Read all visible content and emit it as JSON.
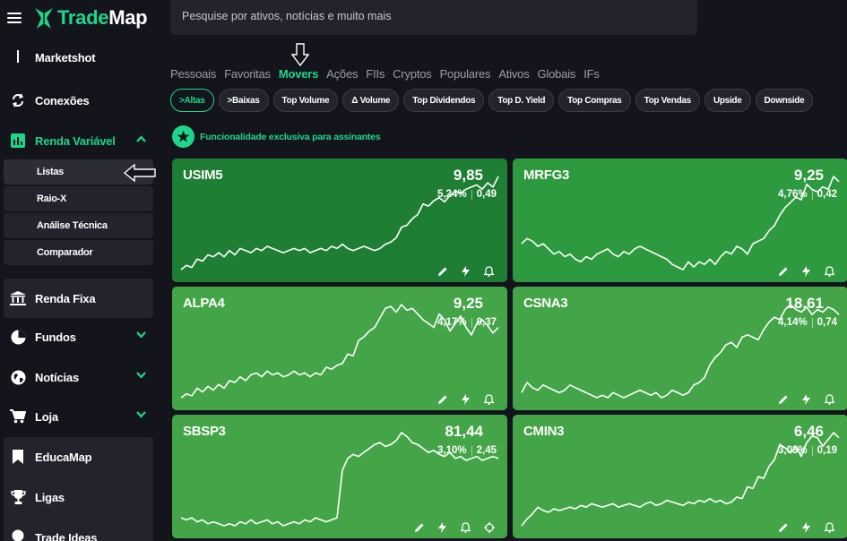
{
  "brand": {
    "name_green": "Trade",
    "name_white": "Map"
  },
  "search": {
    "placeholder": "Pesquise por ativos, notícias e muito mais"
  },
  "sidebar": {
    "partial_item": "Marketshot",
    "items": [
      {
        "label": "Conexões",
        "icon": "sync-icon"
      },
      {
        "label": "Renda Variável",
        "icon": "bar-chart-icon"
      },
      {
        "label": "Renda Fixa",
        "icon": "bank-icon"
      },
      {
        "label": "Fundos",
        "icon": "pie-chart-icon"
      },
      {
        "label": "Notícias",
        "icon": "globe-icon"
      },
      {
        "label": "Loja",
        "icon": "cart-icon"
      },
      {
        "label": "EducaMap",
        "icon": "bookmark-icon"
      },
      {
        "label": "Ligas",
        "icon": "trophy-icon"
      },
      {
        "label": "Trade Ideas",
        "icon": "lightbulb-icon"
      }
    ],
    "sub_items": [
      {
        "label": "Listas"
      },
      {
        "label": "Raio-X"
      },
      {
        "label": "Análise Técnica"
      },
      {
        "label": "Comparador"
      }
    ]
  },
  "tabs": [
    {
      "label": "Pessoais"
    },
    {
      "label": "Favoritas"
    },
    {
      "label": "Movers"
    },
    {
      "label": "Ações"
    },
    {
      "label": "FIIs"
    },
    {
      "label": "Cryptos"
    },
    {
      "label": "Populares"
    },
    {
      "label": "Ativos"
    },
    {
      "label": "Globais"
    },
    {
      "label": "IFs"
    }
  ],
  "active_tab": "Movers",
  "chips": [
    {
      "label": ">Altas"
    },
    {
      "label": ">Baixas"
    },
    {
      "label": "Top Volume"
    },
    {
      "label": "Δ Volume"
    },
    {
      "label": "Top Dividendos"
    },
    {
      "label": "Top D. Yield"
    },
    {
      "label": "Top Compras"
    },
    {
      "label": "Top Vendas"
    },
    {
      "label": "Upside"
    },
    {
      "label": "Downside"
    }
  ],
  "exclusive_notice": "Funcionalidade exclusiva para assinantes",
  "colors": {
    "accent": "#1ed68a",
    "card_dark": "#1e7e33",
    "card_mid": "#2e9a3f",
    "card_light": "#43a547"
  },
  "cards": [
    {
      "symbol": "USIM5",
      "price": "9,85",
      "pct": "5,24%",
      "delta": "0,49",
      "spark": [
        10,
        14,
        12,
        20,
        18,
        24,
        22,
        26,
        22,
        28,
        24,
        30,
        28,
        26,
        30,
        28,
        32,
        30,
        28,
        26,
        28,
        30,
        28,
        30,
        26,
        28,
        30,
        28,
        32,
        30,
        34,
        30,
        28,
        30,
        32,
        30,
        28,
        30,
        34,
        36,
        40,
        50,
        52,
        58,
        62,
        72,
        70,
        75,
        78,
        74,
        80,
        84,
        82,
        86,
        88,
        90,
        86,
        92,
        88,
        98
      ]
    },
    {
      "symbol": "MRFG3",
      "price": "9,25",
      "pct": "4,76%",
      "delta": "0,42",
      "spark": [
        38,
        42,
        40,
        36,
        38,
        34,
        30,
        32,
        28,
        30,
        26,
        24,
        28,
        26,
        30,
        32,
        34,
        30,
        28,
        32,
        30,
        34,
        36,
        34,
        32,
        30,
        28,
        26,
        22,
        20,
        18,
        24,
        20,
        24,
        22,
        26,
        22,
        28,
        32,
        30,
        36,
        34,
        30,
        38,
        40,
        42,
        48,
        52,
        60,
        66,
        70,
        74,
        72,
        84,
        80,
        78,
        82,
        80,
        90,
        86
      ]
    },
    {
      "symbol": "ALPA4",
      "price": "9,25",
      "pct": "4,17%",
      "delta": "0,37",
      "spark": [
        18,
        22,
        20,
        28,
        24,
        30,
        26,
        32,
        28,
        36,
        34,
        40,
        36,
        42,
        44,
        40,
        46,
        42,
        44,
        40,
        42,
        46,
        42,
        44,
        40,
        44,
        42,
        50,
        48,
        52,
        54,
        64,
        62,
        78,
        82,
        88,
        92,
        102,
        112,
        114,
        108,
        116,
        110,
        112,
        106,
        100,
        96,
        92,
        106,
        100,
        88,
        96,
        104,
        92,
        84,
        96,
        100,
        94,
        86,
        92
      ]
    },
    {
      "symbol": "CSNA3",
      "price": "18,61",
      "pct": "4,14%",
      "delta": "0,74",
      "spark": [
        28,
        36,
        32,
        30,
        34,
        32,
        30,
        28,
        30,
        34,
        32,
        30,
        28,
        26,
        24,
        26,
        24,
        28,
        26,
        24,
        26,
        28,
        30,
        28,
        26,
        28,
        24,
        26,
        30,
        28,
        26,
        28,
        34,
        36,
        40,
        50,
        56,
        60,
        66,
        68,
        64,
        72,
        74,
        72,
        70,
        78,
        84,
        88,
        86,
        94,
        98,
        94,
        92,
        96,
        90,
        94,
        92,
        96,
        94,
        90
      ]
    },
    {
      "symbol": "SBSP3",
      "price": "81,44",
      "pct": "3,10%",
      "delta": "2,45",
      "spark": [
        22,
        20,
        22,
        18,
        20,
        16,
        18,
        16,
        14,
        16,
        14,
        18,
        16,
        20,
        16,
        18,
        20,
        16,
        18,
        14,
        16,
        18,
        16,
        20,
        18,
        22,
        20,
        18,
        20,
        22,
        70,
        82,
        86,
        84,
        88,
        92,
        96,
        98,
        94,
        96,
        100,
        108,
        104,
        98,
        96,
        92,
        88,
        90,
        86,
        84,
        88,
        82,
        84,
        80,
        82,
        84,
        80,
        82,
        84,
        82
      ]
    },
    {
      "symbol": "CMIN3",
      "price": "6,46",
      "pct": "3,03%",
      "delta": "0,19",
      "spark": [
        14,
        22,
        28,
        36,
        32,
        30,
        34,
        32,
        34,
        36,
        34,
        38,
        36,
        40,
        38,
        36,
        38,
        40,
        36,
        38,
        40,
        38,
        36,
        40,
        42,
        38,
        40,
        44,
        42,
        40,
        38,
        42,
        40,
        44,
        42,
        46,
        42,
        44,
        40,
        42,
        48,
        46,
        60,
        58,
        72,
        70,
        84,
        92,
        110,
        106,
        100,
        108,
        96,
        112,
        120,
        118,
        108,
        116,
        124,
        118
      ]
    }
  ]
}
